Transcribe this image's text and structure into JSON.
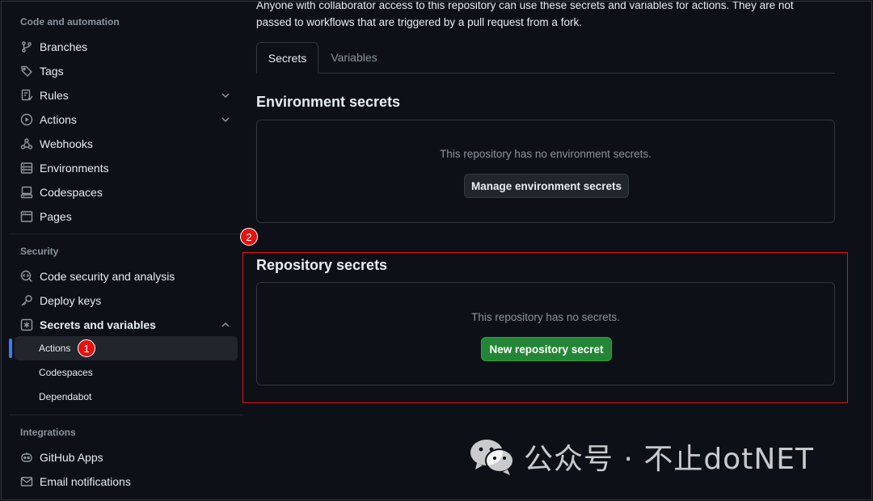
{
  "sidebar": {
    "sections": {
      "code_automation": "Code and automation",
      "security": "Security",
      "integrations": "Integrations"
    },
    "items": {
      "branches": "Branches",
      "tags": "Tags",
      "rules": "Rules",
      "actions": "Actions",
      "webhooks": "Webhooks",
      "environments": "Environments",
      "codespaces": "Codespaces",
      "pages": "Pages",
      "code_security": "Code security and analysis",
      "deploy_keys": "Deploy keys",
      "secrets_variables": "Secrets and variables",
      "github_apps": "GitHub Apps",
      "email_notifications": "Email notifications"
    },
    "sub_items": {
      "actions": "Actions",
      "codespaces": "Codespaces",
      "dependabot": "Dependabot"
    },
    "active_sub_item": "Actions"
  },
  "annotations": {
    "badge_1": "1",
    "badge_2": "2",
    "highlight_color": "#e5120f"
  },
  "main": {
    "intro_line1": "Anyone with collaborator access to this repository can use these secrets and variables for actions. They are not",
    "intro_line2": "passed to workflows that are triggered by a pull request from a fork.",
    "tabs": [
      {
        "label": "Secrets",
        "selected": true
      },
      {
        "label": "Variables",
        "selected": false
      }
    ],
    "environment_secrets": {
      "title": "Environment secrets",
      "empty_message": "This repository has no environment secrets.",
      "button_label": "Manage environment secrets"
    },
    "repository_secrets": {
      "title": "Repository secrets",
      "empty_message": "This repository has no secrets.",
      "button_label": "New repository secret"
    }
  },
  "watermark": {
    "text": "公众号 · 不止dotNET",
    "icon": "wechat-icon"
  },
  "colors": {
    "background": "#0d1117",
    "border": "#30363d",
    "accent_blue": "#2f81f7",
    "button_green": "#238636",
    "muted_text": "#8b949e"
  }
}
